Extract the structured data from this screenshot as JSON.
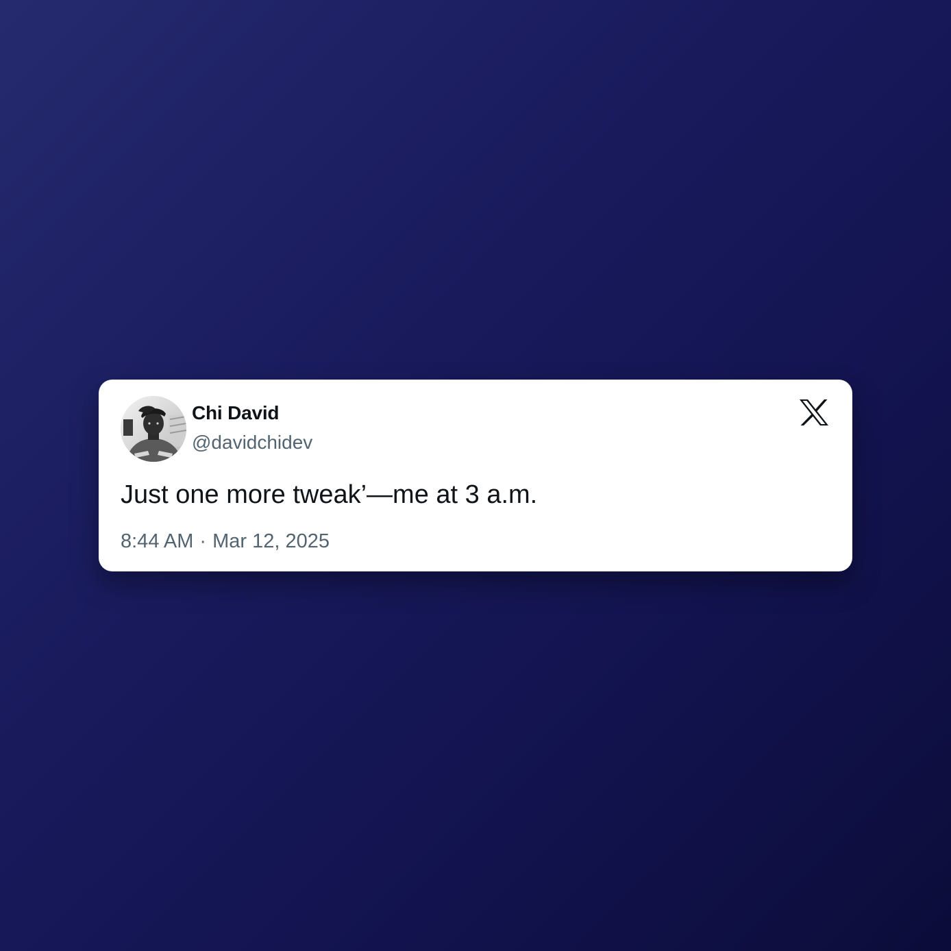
{
  "tweet": {
    "author": {
      "display_name": "Chi David",
      "handle": "@davidchidev",
      "avatar": "profile-photo-avatar"
    },
    "brand_icon": "x-logo-icon",
    "text": "Just one more tweak’—me at 3 a.m.",
    "time": "8:44 AM",
    "separator": "·",
    "date": "Mar 12, 2025"
  },
  "colors": {
    "background_top": "#252a6e",
    "background_bottom": "#0c0c3a",
    "card": "#ffffff",
    "primary_text": "#0f1419",
    "secondary_text": "#536471"
  }
}
